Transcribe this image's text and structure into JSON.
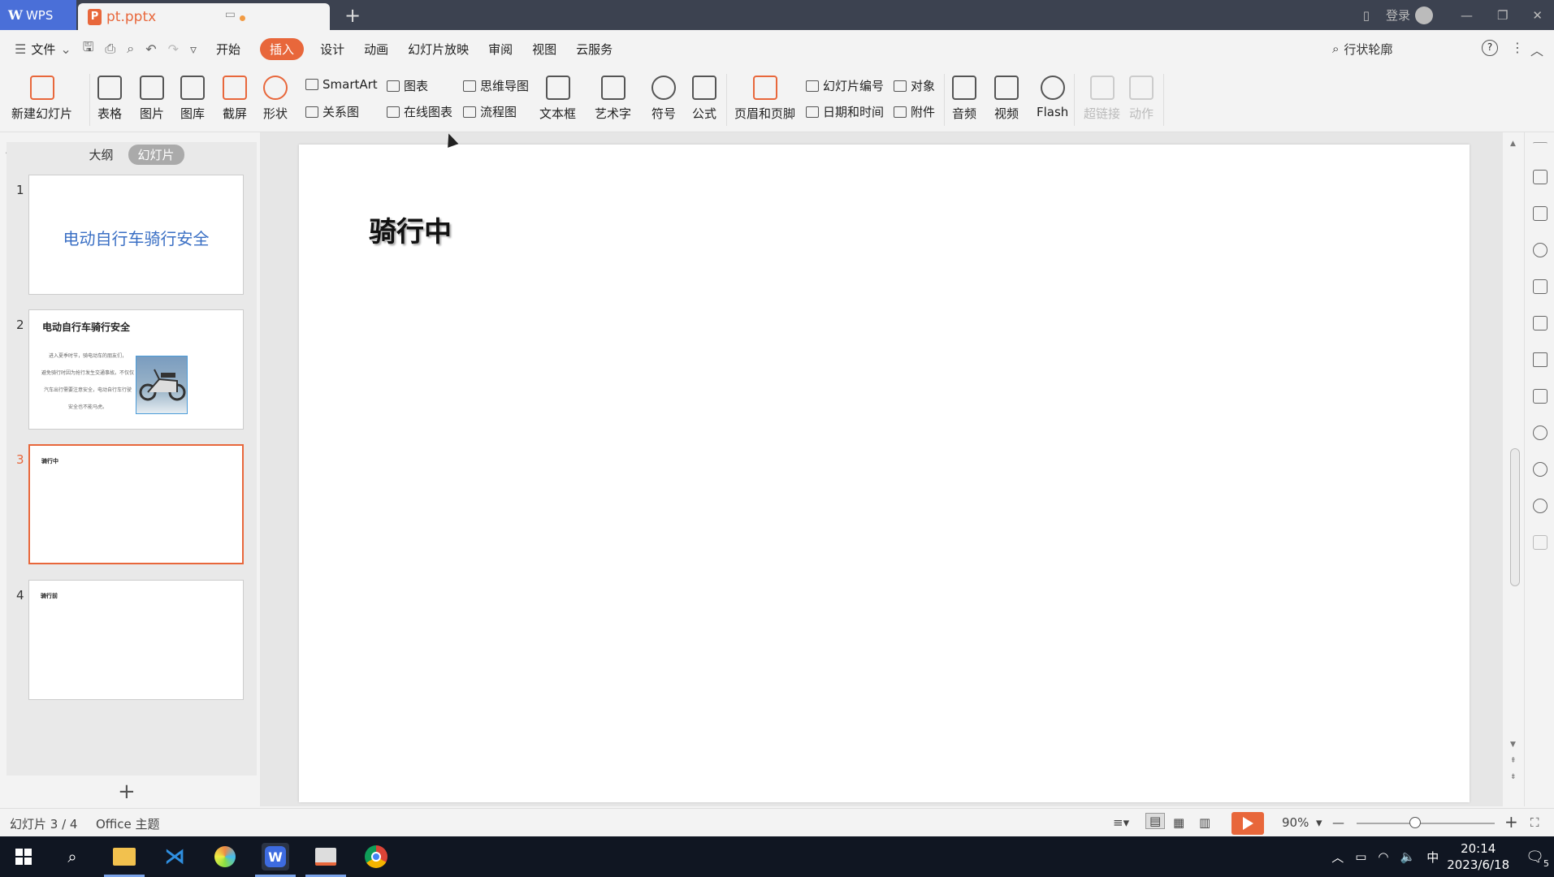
{
  "titlebar": {
    "app_label": "WPS",
    "doc_tab": "pt.pptx",
    "login": "登录"
  },
  "menu": {
    "file": "文件",
    "tabs": [
      "开始",
      "插入",
      "设计",
      "动画",
      "幻灯片放映",
      "审阅",
      "视图",
      "云服务"
    ],
    "active_tab": "插入",
    "search_text": "行状轮廓"
  },
  "ribbon": {
    "new_slide": "新建幻灯片",
    "table": "表格",
    "picture": "图片",
    "gallery": "图库",
    "screenshot": "截屏",
    "shape": "形状",
    "smartart": "SmartArt",
    "chart": "图表",
    "relation": "关系图",
    "online_chart": "在线图表",
    "mindmap": "思维导图",
    "flowchart": "流程图",
    "textbox": "文本框",
    "wordart": "艺术字",
    "symbol": "符号",
    "formula": "公式",
    "header_footer": "页眉和页脚",
    "slide_number": "幻灯片编号",
    "object": "对象",
    "datetime": "日期和时间",
    "attachment": "附件",
    "audio": "音频",
    "video": "视频",
    "flash": "Flash",
    "hyperlink": "超链接",
    "action": "动作"
  },
  "panel": {
    "tab_outline": "大纲",
    "tab_slides": "幻灯片",
    "slides": [
      {
        "num": "1",
        "title": "电动自行车骑行安全"
      },
      {
        "num": "2",
        "title": "电动自行车骑行安全",
        "body": [
          "进入夏季时节，骑电动车的朋友们，",
          "避免骑行时因为抢行发生交通事故。不仅仅",
          "汽车出行需要注意安全，电动自行车行驶",
          "安全也不能马虎。"
        ]
      },
      {
        "num": "3",
        "title": "骑行中"
      },
      {
        "num": "4",
        "title": "骑行前"
      }
    ],
    "current": "3"
  },
  "slide": {
    "title": "骑行中"
  },
  "status": {
    "slide_counter": "幻灯片 3 / 4",
    "theme": "Office 主题",
    "zoom": "90%"
  },
  "taskbar": {
    "time": "20:14",
    "date": "2023/6/18",
    "ime": "中",
    "notif_count": "5"
  },
  "colors": {
    "accent": "#e8673b",
    "wps_blue": "#4a6fd8",
    "titlebar": "#3c4250",
    "thumb_title_blue": "#3a6fc4"
  }
}
